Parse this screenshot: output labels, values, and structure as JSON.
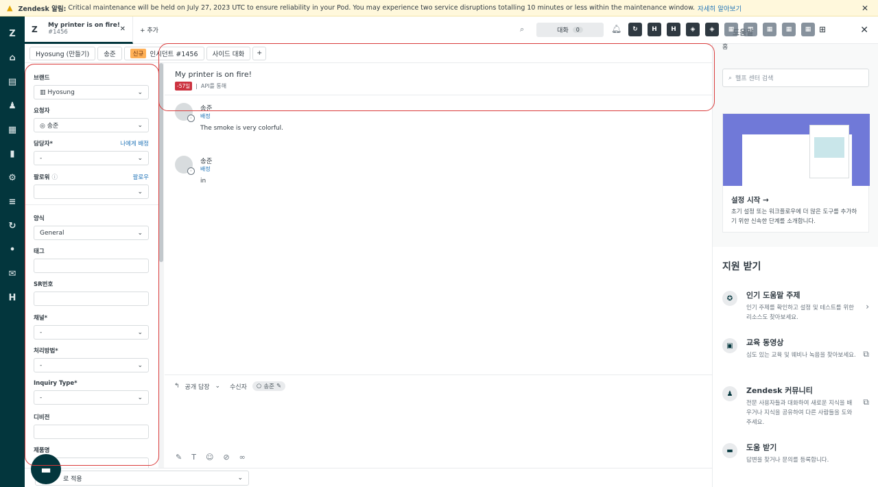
{
  "banner": {
    "brand": "Zendesk 알림:",
    "message": "Critical maintenance will be held on July 27, 2023 UTC to ensure reliability in your Pod. You may experience two service disruptions totalling 10 minutes or less within the maintenance window.",
    "link": "자세히 알아보기"
  },
  "topbar": {
    "tab_title": "My printer is on fire!",
    "tab_id": "#1456",
    "add_tab": "+ 추가",
    "conversations_label": "대화",
    "conversations_count": "0",
    "app_labels": [
      "H",
      "H"
    ],
    "panel_title": "도움말"
  },
  "subtabs": {
    "org": "Hyosung (만들기)",
    "user": "송준",
    "status_badge": "신규",
    "ticket": "인시던트 #1456",
    "side": "사이드 대화",
    "plus": "+"
  },
  "fields": {
    "brand_label": "브랜드",
    "brand_value": "Hyosung",
    "requester_label": "요청자",
    "requester_value": "송준",
    "assignee_label": "담당자*",
    "assignee_link": "나에게 배정",
    "assignee_value": "-",
    "followers_label": "팔로워",
    "followers_link": "팔로우",
    "form_label": "양식",
    "form_value": "General",
    "tags_label": "태그",
    "sr_label": "SR번호",
    "channel_label": "채널*",
    "channel_value": "-",
    "method_label": "처리방법*",
    "method_value": "-",
    "inquiry_label": "Inquiry Type*",
    "inquiry_value": "-",
    "division_label": "디비전",
    "product_label": "제품명"
  },
  "conversation": {
    "subject": "My printer is on fire!",
    "badge": "-57일",
    "via": "API를 통해",
    "messages": [
      {
        "name": "송준",
        "via": "배정",
        "text": "The smoke is very colorful."
      },
      {
        "name": "송준",
        "via": "배정",
        "text": "in"
      }
    ]
  },
  "editor": {
    "reply_type": "공개 답장",
    "recipient_label": "수신자",
    "recipient": "송준"
  },
  "bottom": {
    "macro": "로 적용"
  },
  "help_panel": {
    "home": "홈",
    "search_placeholder": "헬프 센터 검색",
    "card_title": "설정 시작 →",
    "card_desc": "초기 설정 또는 워크플로우에 더 많은 도구를 추가하기 위한 신속한 단계를 소개합니다.",
    "support_title": "지원 받기",
    "items": [
      {
        "title": "인기 도움말 주제",
        "desc": "인기 주제를 확인하고 설정 및 테스트를 위한 리소스도 찾아보세요."
      },
      {
        "title": "교육 동영상",
        "desc": "심도 있는 교육 및 웨비나 녹음을 찾아보세요."
      },
      {
        "title": "Zendesk 커뮤니티",
        "desc": "전문 사용자들과 대화하여 새로운 지식을 배우거나 지식을 공유하여 다른 사람들을 도와주세요."
      },
      {
        "title": "도움 받기",
        "desc": "답변을 찾거나 문의를 등록합니다."
      }
    ]
  },
  "colors": {
    "nav": "#03363d",
    "accent": "#1f73b7",
    "annotation": "#d93a3a",
    "badge_new": "#ffb057"
  }
}
